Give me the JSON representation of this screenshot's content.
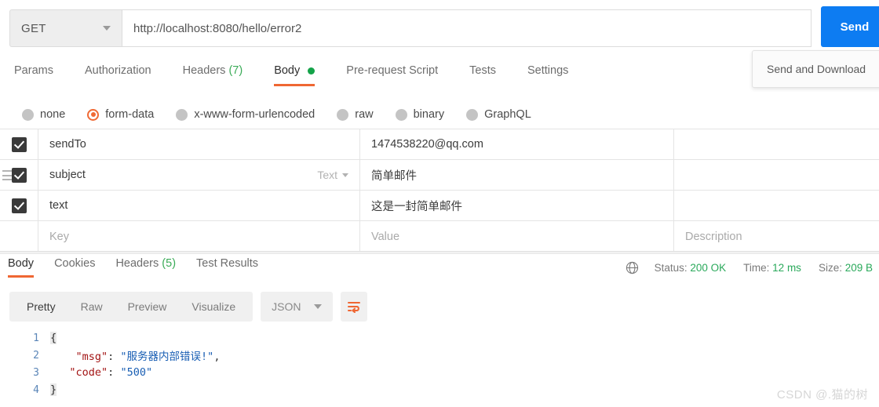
{
  "request": {
    "method": "GET",
    "url": "http://localhost:8080/hello/error2",
    "send_label": "Send",
    "send_dropdown_item": "Send and Download",
    "tabs": [
      {
        "label": "Params",
        "count": "",
        "active": false,
        "dot": false
      },
      {
        "label": "Authorization",
        "count": "",
        "active": false,
        "dot": false
      },
      {
        "label": "Headers",
        "count": "(7)",
        "active": false,
        "dot": false
      },
      {
        "label": "Body",
        "count": "",
        "active": true,
        "dot": true
      },
      {
        "label": "Pre-request Script",
        "count": "",
        "active": false,
        "dot": false
      },
      {
        "label": "Tests",
        "count": "",
        "active": false,
        "dot": false
      },
      {
        "label": "Settings",
        "count": "",
        "active": false,
        "dot": false
      }
    ],
    "body_types": [
      {
        "label": "none",
        "selected": false
      },
      {
        "label": "form-data",
        "selected": true
      },
      {
        "label": "x-www-form-urlencoded",
        "selected": false
      },
      {
        "label": "raw",
        "selected": false
      },
      {
        "label": "binary",
        "selected": false
      },
      {
        "label": "GraphQL",
        "selected": false
      }
    ],
    "table": {
      "placeholders": {
        "key": "Key",
        "value": "Value",
        "description": "Description"
      },
      "rows": [
        {
          "checked": true,
          "key": "sendTo",
          "type": "",
          "value": "1474538220@qq.com",
          "description": "",
          "handle": false
        },
        {
          "checked": true,
          "key": "subject",
          "type": "Text",
          "value": "简单邮件",
          "description": "",
          "handle": true
        },
        {
          "checked": true,
          "key": "text",
          "type": "",
          "value": "这是一封简单邮件",
          "description": "",
          "handle": false
        }
      ]
    }
  },
  "response": {
    "tabs": [
      {
        "label": "Body",
        "count": "",
        "active": true
      },
      {
        "label": "Cookies",
        "count": "",
        "active": false
      },
      {
        "label": "Headers",
        "count": "(5)",
        "active": false
      },
      {
        "label": "Test Results",
        "count": "",
        "active": false
      }
    ],
    "meta": {
      "status_label": "Status:",
      "status_value": "200 OK",
      "time_label": "Time:",
      "time_value": "12 ms",
      "size_label": "Size:",
      "size_value": "209 B"
    },
    "format_buttons": [
      {
        "label": "Pretty",
        "active": true
      },
      {
        "label": "Raw",
        "active": false
      },
      {
        "label": "Preview",
        "active": false
      },
      {
        "label": "Visualize",
        "active": false
      }
    ],
    "language": "JSON",
    "code_lines": [
      {
        "num": "1",
        "segments": [
          {
            "t": "{",
            "c": "tok-brace"
          }
        ]
      },
      {
        "num": "2",
        "segments": [
          {
            "t": "    ",
            "c": "tok-punc"
          },
          {
            "t": "\"msg\"",
            "c": "tok-key"
          },
          {
            "t": ": ",
            "c": "tok-punc"
          },
          {
            "t": "\"服务器内部错误!\"",
            "c": "tok-str"
          },
          {
            "t": ",",
            "c": "tok-punc"
          }
        ]
      },
      {
        "num": "3",
        "segments": [
          {
            "t": "   ",
            "c": "tok-punc"
          },
          {
            "t": "\"code\"",
            "c": "tok-key"
          },
          {
            "t": ": ",
            "c": "tok-punc"
          },
          {
            "t": "\"500\"",
            "c": "tok-str"
          }
        ]
      },
      {
        "num": "4",
        "segments": [
          {
            "t": "}",
            "c": "tok-brace"
          }
        ]
      }
    ]
  },
  "watermark": "CSDN @.猫的树",
  "colors": {
    "accent_orange": "#ef6733",
    "send_blue": "#0d7cf2",
    "status_green": "#2aab5b",
    "json_key_red": "#a31515",
    "json_string_blue": "#1a5fb4"
  }
}
